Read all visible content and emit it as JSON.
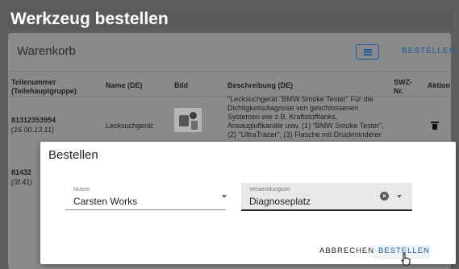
{
  "page": {
    "title": "Werkzeug bestellen"
  },
  "cart": {
    "title": "Warenkorb",
    "list_button_icon": "list-icon",
    "order_link": "BESTELLEN",
    "headers": {
      "part_no": "Teilenummer",
      "part_group": "(Teilehauptgruppe)",
      "name": "Name (DE)",
      "image": "Bild",
      "description": "Beschreibung (DE)",
      "swz_1": "SWZ-",
      "swz_2": "Nr.",
      "action": "Aktion"
    },
    "rows": [
      {
        "part_no": "81312353954",
        "group": "(16.00.13.11)",
        "name": "Lecksuchgerät",
        "desc": [
          "\"Lecksuchgerät \"BMW Smoke Tester\" Für die",
          "Dichtigkeitsdiagnose von geschlossenen",
          "Systemen wie z.B. Kraftstofftanks,",
          "Ansaugluftkanäle usw.  (1) \"BMW Smoke Tester\",",
          "(2) \"UltraTracer\", (3) Flasche mit Druckminderer"
        ],
        "action_icon": "trash-icon"
      },
      {
        "part_no": "81432",
        "group": "(3f.41)",
        "action_icon": "trash-icon"
      }
    ]
  },
  "dialog": {
    "title": "Bestellen",
    "user_field": {
      "label": "Nutzer",
      "value": "Carsten Works"
    },
    "use_field": {
      "label": "Verwendungsort",
      "value": "Diagnoseplatz"
    },
    "clear_symbol": "×",
    "cancel": "ABBRECHEN",
    "confirm": "BESTELLEN"
  }
}
